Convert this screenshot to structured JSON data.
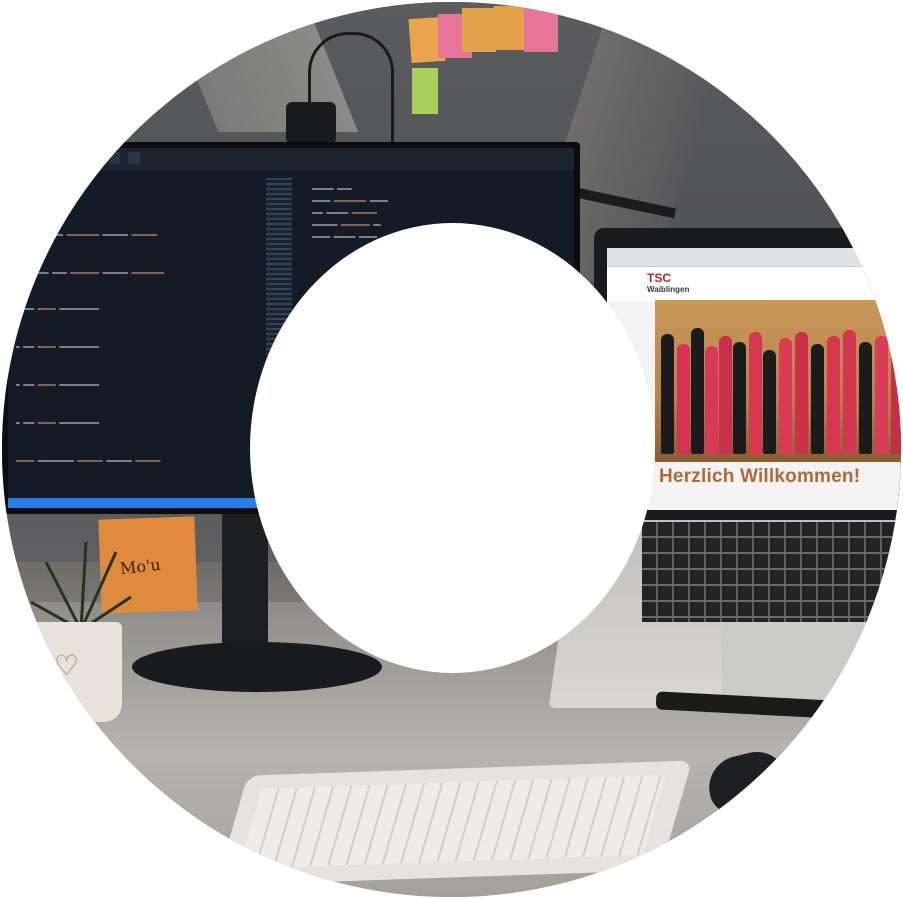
{
  "scene": {
    "description_tags": [
      "desk-photo",
      "circular-crop"
    ],
    "colors": {
      "background": "#ffffff",
      "code_bg": "#131b26",
      "brand_red": "#b7282e",
      "welcome_text": "#b06a3a",
      "sticky_orange": "#e08a3e"
    }
  },
  "laptop": {
    "brand_line1": "TSC",
    "brand_line2": "Waiblingen",
    "welcome": "Herzlich Willkommen!"
  },
  "sticky_note": {
    "text": "Mo'u"
  }
}
